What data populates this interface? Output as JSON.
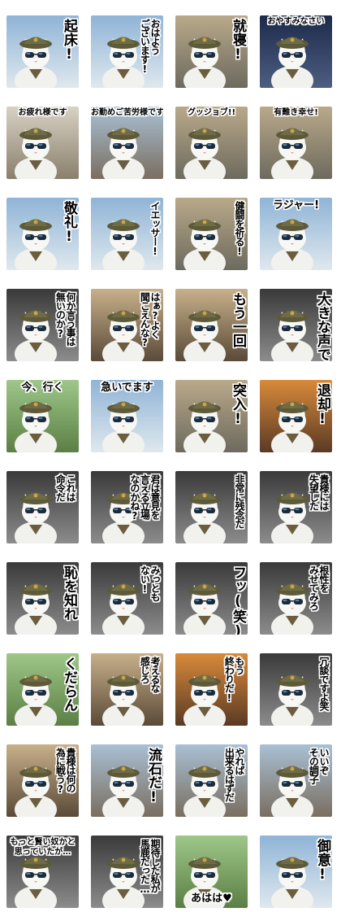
{
  "tiles": [
    {
      "text": "起床!",
      "style": "v big right",
      "scene": "sky"
    },
    {
      "text": "おはよう\nございます!",
      "style": "v right",
      "scene": "sky"
    },
    {
      "text": "就寝!",
      "style": "v big right",
      "scene": "field"
    },
    {
      "text": "おやすみなさい",
      "style": "h",
      "scene": "night"
    },
    {
      "text": "お疲れ様です",
      "style": "h",
      "scene": "cafe"
    },
    {
      "text": "お勤めご苦労様です",
      "style": "h",
      "scene": "town"
    },
    {
      "text": "グッジョブ!!",
      "style": "h",
      "scene": "field"
    },
    {
      "text": "有難き幸せ!",
      "style": "h",
      "scene": "field"
    },
    {
      "text": "敬礼!",
      "style": "v big right",
      "scene": "sky"
    },
    {
      "text": "イエッサー!",
      "style": "v right",
      "scene": "sky"
    },
    {
      "text": "健闘を祈る!",
      "style": "v right",
      "scene": "field"
    },
    {
      "text": "ラジャー!",
      "style": "h big",
      "scene": "sky"
    },
    {
      "text": "何か言う事は\n無いのか?",
      "style": "v right",
      "scene": "dark"
    },
    {
      "text": "はぁ?よく\n聞こえんな?",
      "style": "v right",
      "scene": "warm"
    },
    {
      "text": "もう一回",
      "style": "v big right",
      "scene": "warm"
    },
    {
      "text": "大きな声で",
      "style": "v big right",
      "scene": "dark"
    },
    {
      "text": "今、行く",
      "style": "h big",
      "scene": "grass"
    },
    {
      "text": "急いでます",
      "style": "h big",
      "scene": "sky"
    },
    {
      "text": "突入!",
      "style": "v big right",
      "scene": "field"
    },
    {
      "text": "退却!",
      "style": "v big right",
      "scene": "fire"
    },
    {
      "text": "これは\n命令だ",
      "style": "v right",
      "scene": "dark"
    },
    {
      "text": "君は意見を\n言える立場\nなのかね?",
      "style": "v right",
      "scene": "dark"
    },
    {
      "text": "非常に残念だ",
      "style": "v right",
      "scene": "dark"
    },
    {
      "text": "貴様には\n失望した",
      "style": "v right",
      "scene": "dark"
    },
    {
      "text": "恥を知れ",
      "style": "v big right",
      "scene": "dark"
    },
    {
      "text": "みっとも\nない!",
      "style": "v right",
      "scene": "dark"
    },
    {
      "text": "フッ(笑)",
      "style": "v big right",
      "scene": "dark"
    },
    {
      "text": "根性を\nみせてみろ",
      "style": "v right",
      "scene": "dark"
    },
    {
      "text": "くだらん",
      "style": "v big right",
      "scene": "grass"
    },
    {
      "text": "考えるな\n感じろ",
      "style": "v right",
      "scene": "warm"
    },
    {
      "text": "もう\n終わりだ!",
      "style": "v right",
      "scene": "fire"
    },
    {
      "text": "冗談ですよ笑",
      "style": "v right",
      "scene": "dark"
    },
    {
      "text": "貴様は何の\n為に戦う?",
      "style": "v right",
      "scene": "warm"
    },
    {
      "text": "流石だ!",
      "style": "v big right",
      "scene": "town"
    },
    {
      "text": "やれば\n出来るはずだ",
      "style": "v right",
      "scene": "town"
    },
    {
      "text": "いいぞ\nその調子",
      "style": "v right",
      "scene": "town"
    },
    {
      "text": "もっと賢い奴かと\n思っていたが…",
      "style": "h twoline",
      "scene": "dark"
    },
    {
      "text": "期待した私が\n馬鹿だった…",
      "style": "v right",
      "scene": "dark"
    },
    {
      "text": "あはは♥",
      "style": "h big bottom",
      "scene": "grass"
    },
    {
      "text": "御意!",
      "style": "v big right",
      "scene": "sky"
    }
  ],
  "scenes": {
    "sky": [
      "#8fb4d6",
      "#dfe8ee"
    ],
    "field": [
      "#b9a98a",
      "#6d6a5e"
    ],
    "night": [
      "#1d2a4a",
      "#4d5e82"
    ],
    "cafe": [
      "#d8d2c4",
      "#8a7f6c"
    ],
    "town": [
      "#a9c0d4",
      "#7a6e60"
    ],
    "dark": [
      "#3a3a3a",
      "#8c8c8c"
    ],
    "warm": [
      "#c7b08a",
      "#5a4a38"
    ],
    "grass": [
      "#9fc78a",
      "#5b7f44"
    ],
    "fire": [
      "#d98a3a",
      "#5a3a24"
    ]
  }
}
